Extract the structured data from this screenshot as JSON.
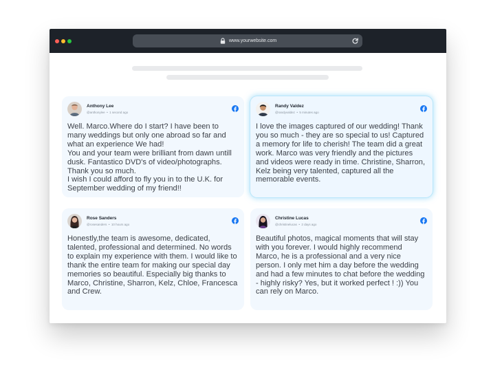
{
  "browser": {
    "url": "www.yourwebsite.com",
    "icons": {
      "lock": "lock-icon",
      "reload": "reload-icon"
    },
    "traffic_lights": {
      "close": "#fe5f57",
      "minimize": "#febc2e",
      "maximize": "#28c840"
    }
  },
  "colors": {
    "brand_facebook": "#1877f2",
    "card_bg": "#f2f8fe",
    "highlight_border": "#b9e6fa"
  },
  "reviews": [
    {
      "name": "Anthony Lee",
      "handle": "@anthonylee",
      "time": "1 second ago",
      "text": "Well. Marco.Where do I start? I have been to many weddings but only one abroad so far and what an experience We had!\nYou and your team were brilliant from dawn untill dusk. Fantastico DVD's of video/photographs. Thank you so much.\nI wish I could afford to fly you in to the U.K. for September wedding of my friend!!",
      "source_icon": "facebook-icon"
    },
    {
      "name": "Randy Valdez",
      "handle": "@randyvaldez",
      "time": "5 minutes ago",
      "text": "I love the images captured of our wedding! Thank you so much - they are so special to us! Captured a memory for life to cherish! The team did a great work. Marco was very friendly and the pictures and videos were ready in time. Christine, Sharron, Kelz being very talented, captured all the memorable events.",
      "source_icon": "facebook-icon"
    },
    {
      "name": "Rose Sanders",
      "handle": "@rosesanders",
      "time": "10 hours ago",
      "text": "Honestly,the team is awesome, dedicated, talented, professional and determined. No words to explain my experience with them. I would like to thank the entire team for making our special day memories so beautiful. Especially big thanks to Marco, Christine, Sharron, Kelz, Chloe, Francesca and Crew.",
      "source_icon": "facebook-icon"
    },
    {
      "name": "Christine Lucas",
      "handle": "@christinelucas",
      "time": "2 days ago",
      "text": "Beautiful photos, magical moments that will stay with you forever. I would highly recommend Marco, he is a professional and a very nice person. I only met him a day before the wedding and had a few minutes to chat before the wedding - highly risky? Yes, but it worked perfect ! :)) You can rely on Marco.",
      "source_icon": "facebook-icon"
    }
  ]
}
